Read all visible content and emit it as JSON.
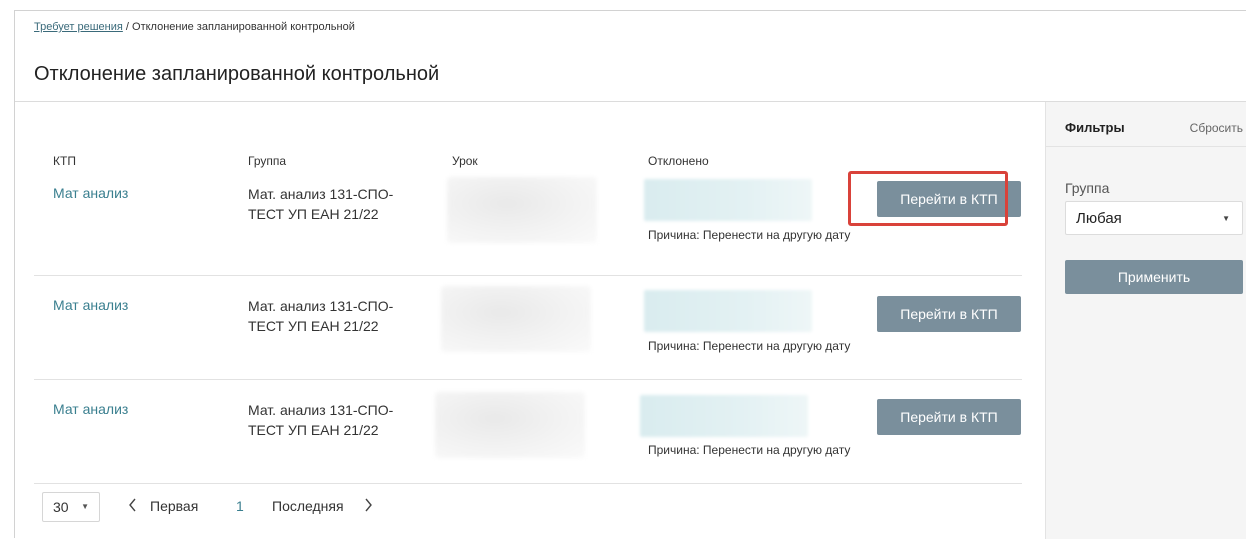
{
  "breadcrumb": {
    "link": "Требует решения",
    "separator": " / ",
    "current": "Отклонение запланированной контрольной"
  },
  "page": {
    "title": "Отклонение запланированной контрольной"
  },
  "table": {
    "columns": {
      "ktp": "КТП",
      "group": "Группа",
      "lesson": "Урок",
      "rejected": "Отклонено"
    },
    "rows": [
      {
        "ktp": "Мат анализ",
        "group": "Мат. анализ 131-СПО-ТЕСТ УП ЕАН 21/22",
        "reason": "Причина: Перенести на другую дату",
        "button": "Перейти в КТП"
      },
      {
        "ktp": "Мат анализ",
        "group": "Мат. анализ 131-СПО-ТЕСТ УП ЕАН 21/22",
        "reason": "Причина: Перенести на другую дату",
        "button": "Перейти в КТП"
      },
      {
        "ktp": "Мат анализ",
        "group": "Мат. анализ 131-СПО-ТЕСТ УП ЕАН 21/22",
        "reason": "Причина: Перенести на другую дату",
        "button": "Перейти в КТП"
      }
    ]
  },
  "pager": {
    "per_page": "30",
    "first": "Первая",
    "page": "1",
    "last": "Последняя",
    "prev_icon": "chevron-left-icon",
    "next_icon": "chevron-right-icon"
  },
  "filters": {
    "title": "Фильтры",
    "reset": "Сбросить",
    "group_label": "Группа",
    "group_value": "Любая",
    "apply": "Применить"
  },
  "colors": {
    "button": "#7a8f9c",
    "link": "#3a7f8f",
    "highlight": "#d9423a"
  }
}
